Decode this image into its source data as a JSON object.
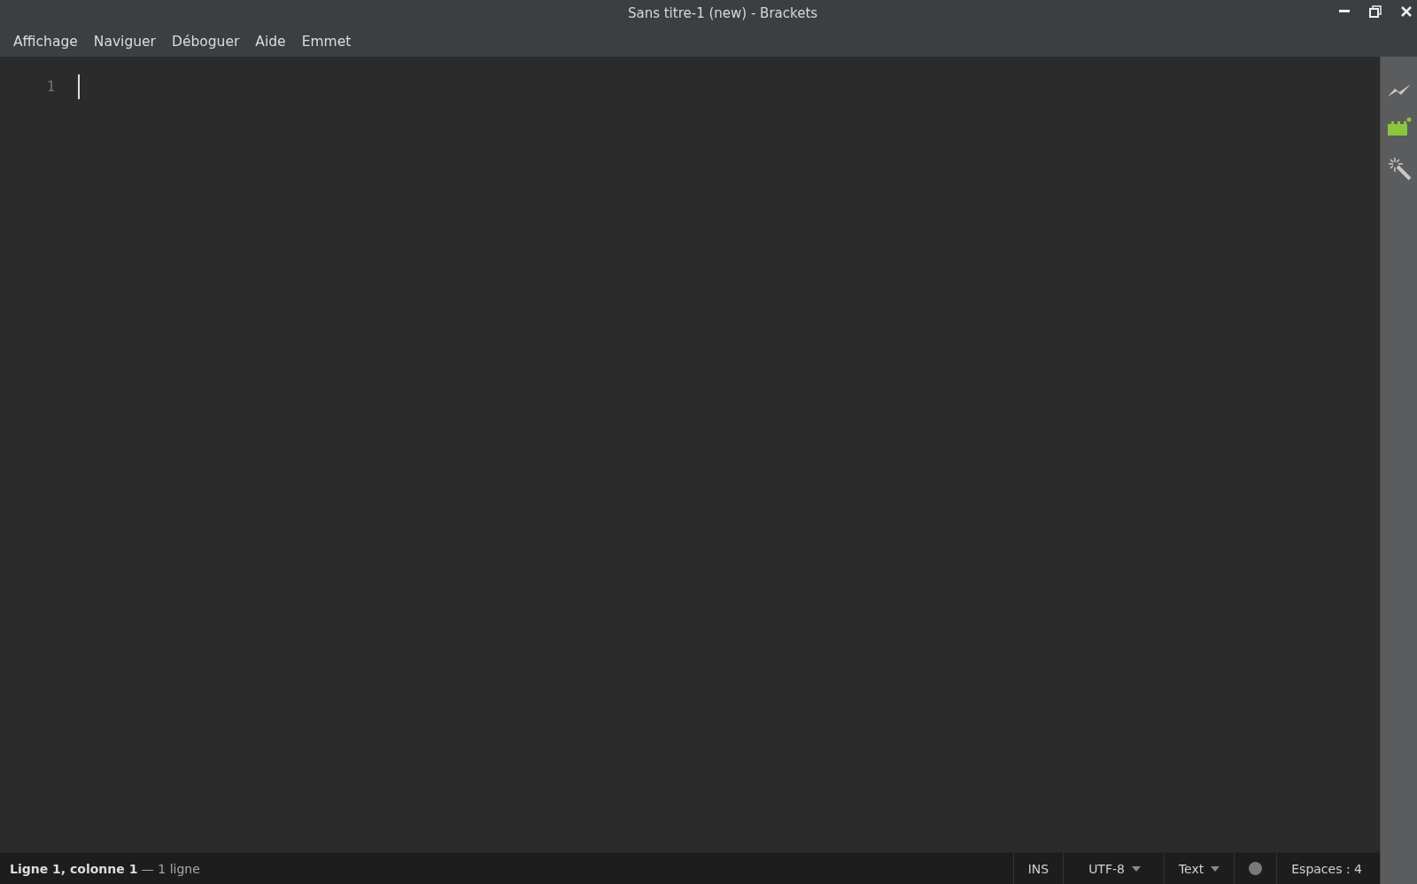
{
  "window": {
    "title": "Sans titre-1 (new) - Brackets"
  },
  "menu": [
    "Affichage",
    "Naviguer",
    "Déboguer",
    "Aide",
    "Emmet"
  ],
  "editor": {
    "line_numbers": [
      "1"
    ]
  },
  "status_bar": {
    "position": "**Ligne 1, colonne 1** — 1 ligne",
    "mode": "INS",
    "encoding": "UTF-8",
    "language": "Text",
    "indent": "Espaces : 4"
  }
}
